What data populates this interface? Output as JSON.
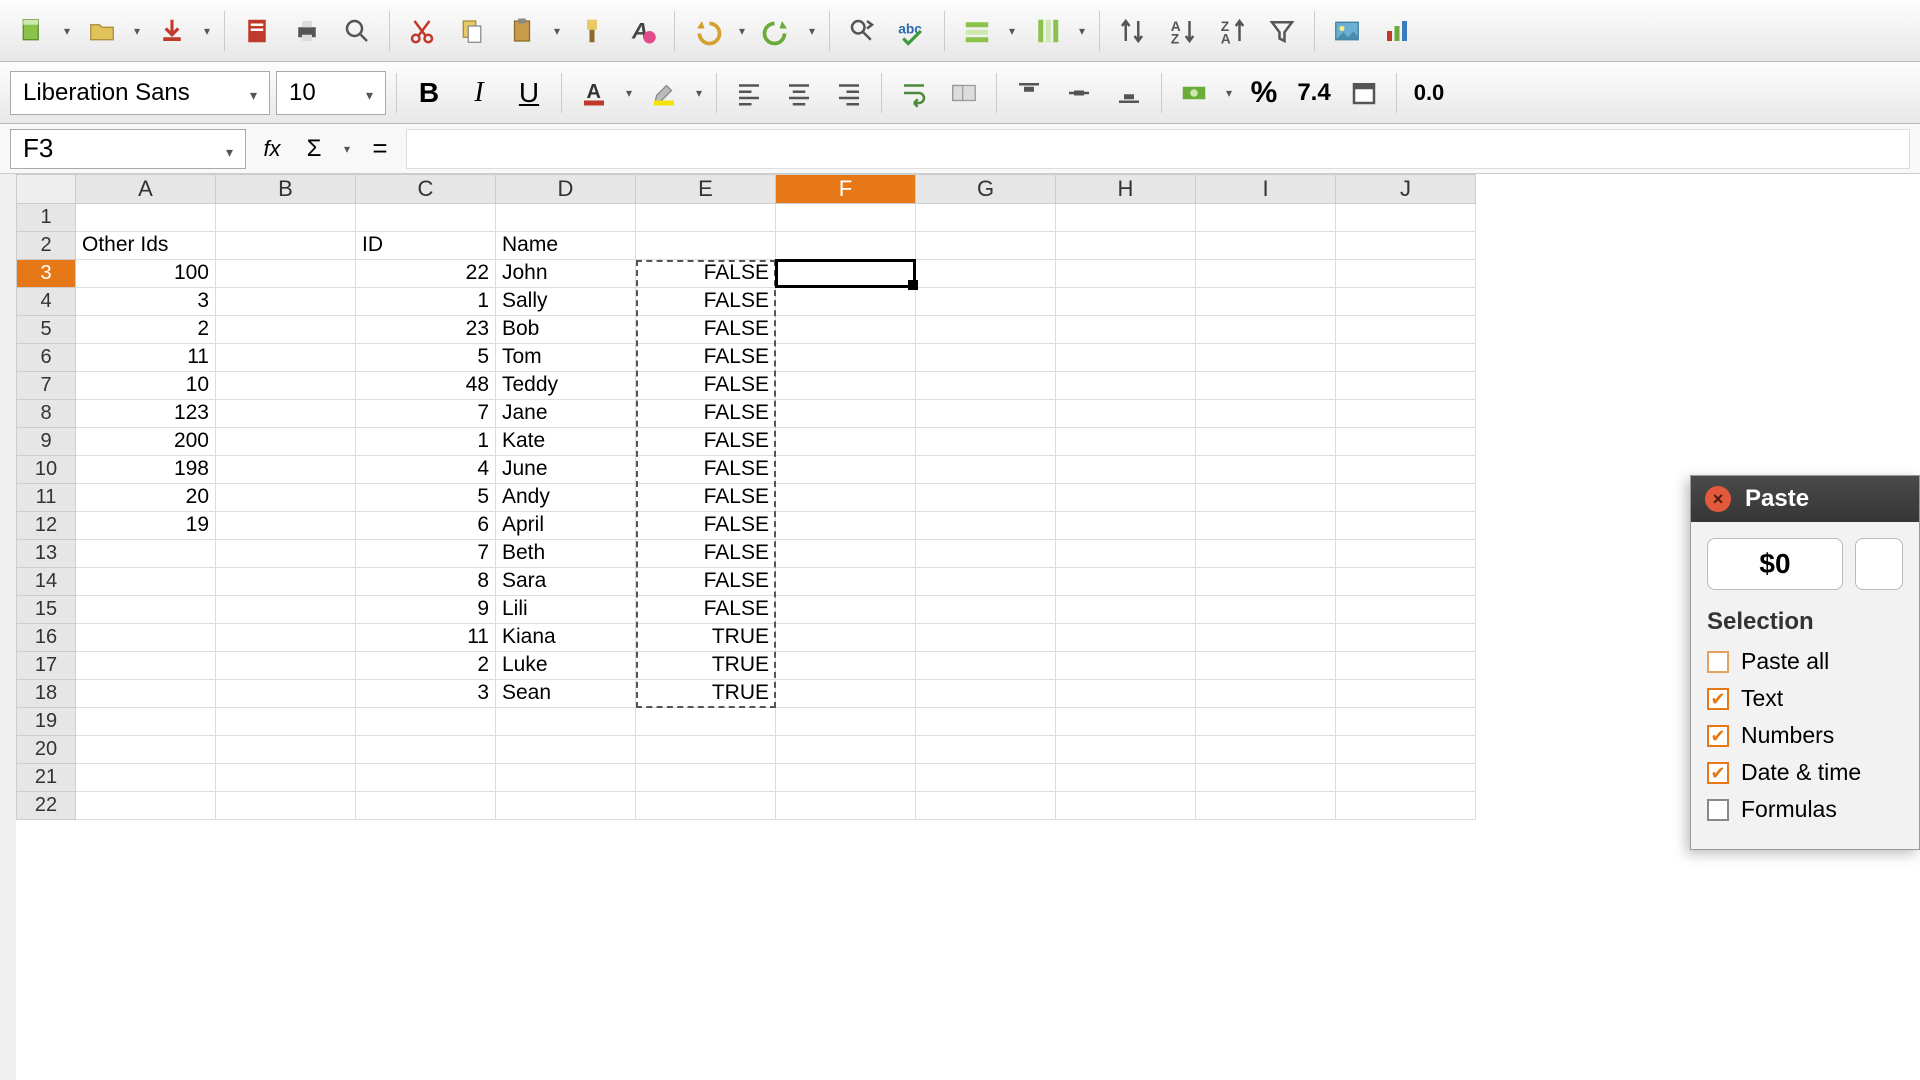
{
  "font": {
    "family": "Liberation Sans",
    "size": "10"
  },
  "cellref": "F3",
  "formula": "",
  "columns": [
    "A",
    "B",
    "C",
    "D",
    "E",
    "F",
    "G",
    "H",
    "I",
    "J"
  ],
  "selected_col_index": 5,
  "selected_row_index": 2,
  "rows_count": 22,
  "chart_data": {
    "type": "table",
    "headers_row": 2,
    "data": [
      {
        "row": 2,
        "A": "Other Ids",
        "C": "ID",
        "D": "Name"
      },
      {
        "row": 3,
        "A": "100",
        "C": "22",
        "D": "John",
        "E": "FALSE"
      },
      {
        "row": 4,
        "A": "3",
        "C": "1",
        "D": "Sally",
        "E": "FALSE"
      },
      {
        "row": 5,
        "A": "2",
        "C": "23",
        "D": "Bob",
        "E": "FALSE"
      },
      {
        "row": 6,
        "A": "11",
        "C": "5",
        "D": "Tom",
        "E": "FALSE"
      },
      {
        "row": 7,
        "A": "10",
        "C": "48",
        "D": "Teddy",
        "E": "FALSE"
      },
      {
        "row": 8,
        "A": "123",
        "C": "7",
        "D": "Jane",
        "E": "FALSE"
      },
      {
        "row": 9,
        "A": "200",
        "C": "1",
        "D": "Kate",
        "E": "FALSE"
      },
      {
        "row": 10,
        "A": "198",
        "C": "4",
        "D": "June",
        "E": "FALSE"
      },
      {
        "row": 11,
        "A": "20",
        "C": "5",
        "D": "Andy",
        "E": "FALSE"
      },
      {
        "row": 12,
        "A": "19",
        "C": "6",
        "D": "April",
        "E": "FALSE"
      },
      {
        "row": 13,
        "C": "7",
        "D": "Beth",
        "E": "FALSE"
      },
      {
        "row": 14,
        "C": "8",
        "D": "Sara",
        "E": "FALSE"
      },
      {
        "row": 15,
        "C": "9",
        "D": "Lili",
        "E": "FALSE"
      },
      {
        "row": 16,
        "C": "11",
        "D": "Kiana",
        "E": "TRUE"
      },
      {
        "row": 17,
        "C": "2",
        "D": "Luke",
        "E": "TRUE"
      },
      {
        "row": 18,
        "C": "3",
        "D": "Sean",
        "E": "TRUE"
      }
    ]
  },
  "dialog": {
    "title": "Paste",
    "shortcut_value": "$0",
    "section": "Selection",
    "options": [
      {
        "label": "Paste all",
        "checked": false,
        "highlight": true
      },
      {
        "label": "Text",
        "checked": true
      },
      {
        "label": "Numbers",
        "checked": true
      },
      {
        "label": "Date & time",
        "checked": true
      },
      {
        "label": "Formulas",
        "checked": false
      }
    ]
  },
  "format_labels": {
    "percent": "%",
    "num": "7.4",
    "decimal": "0.0"
  },
  "toolbar_icons": {
    "new": "new-file-icon",
    "open": "open-folder-icon",
    "save": "save-icon",
    "pdf": "pdf-icon",
    "print": "printer-icon",
    "preview": "magnifier-icon",
    "cut": "scissors-icon",
    "copy": "copy-icon",
    "paste": "clipboard-icon",
    "brush": "format-paintbrush-icon",
    "clear": "clear-format-icon",
    "undo": "undo-icon",
    "redo": "redo-icon",
    "find": "find-replace-icon",
    "spell": "spellcheck-icon",
    "row": "insert-row-icon",
    "col": "insert-col-icon",
    "sort": "sort-icon",
    "sortasc": "sort-asc-icon",
    "sortdesc": "sort-desc-icon",
    "filter": "autofilter-icon",
    "image": "insert-image-icon",
    "chart": "chart-icon"
  }
}
